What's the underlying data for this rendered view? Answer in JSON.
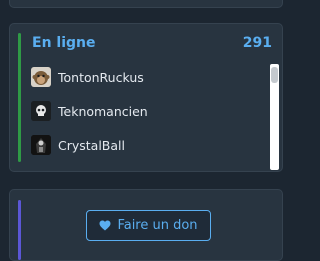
{
  "online": {
    "title": "En ligne",
    "count": "291",
    "members": [
      {
        "name": "TontonRuckus",
        "avatar_icon": "monkey-avatar"
      },
      {
        "name": "Teknomancien",
        "avatar_icon": "skull-avatar"
      },
      {
        "name": "CrystalBall",
        "avatar_icon": "cloaked-figure-avatar"
      }
    ]
  },
  "donate": {
    "label": "Faire un don",
    "icon": "heart-icon"
  },
  "colors": {
    "accent_blue": "#5aaef0",
    "online_bar": "#2f9a46",
    "donate_bar": "#5b57d6",
    "panel_bg": "#283440",
    "page_bg": "#1c2631"
  }
}
